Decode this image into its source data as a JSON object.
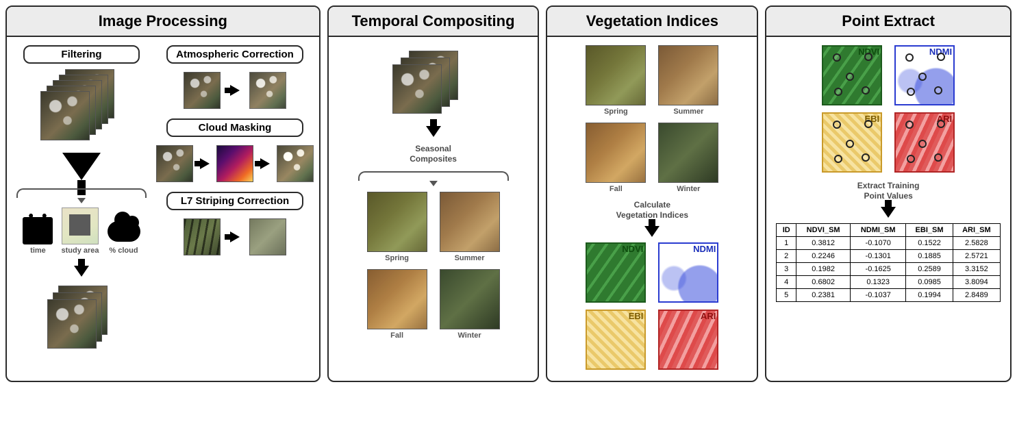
{
  "panels": {
    "image_processing": {
      "title": "Image Processing",
      "filtering_label": "Filtering",
      "atmos_label": "Atmospheric Correction",
      "cloud_label": "Cloud Masking",
      "striping_label": "L7 Striping Correction",
      "time_caption": "time",
      "area_caption": "study area",
      "cloud_caption": "% cloud"
    },
    "temporal": {
      "title": "Temporal Compositing",
      "subtitle": "Seasonal\nComposites",
      "seasons": [
        "Spring",
        "Summer",
        "Fall",
        "Winter"
      ]
    },
    "veg": {
      "title": "Vegetation Indices",
      "calc_label": "Calculate\nVegetation Indices",
      "seasons": [
        "Spring",
        "Summer",
        "Fall",
        "Winter"
      ],
      "indices": {
        "ndvi": "NDVI",
        "ndmi": "NDMI",
        "ebi": "EBI",
        "ari": "ARI"
      }
    },
    "point": {
      "title": "Point Extract",
      "extract_label": "Extract Training\nPoint Values",
      "indices": {
        "ndvi": "NDVI",
        "ndmi": "NDMI",
        "ebi": "EBI",
        "ari": "ARI"
      },
      "table": {
        "headers": [
          "ID",
          "NDVI_SM",
          "NDMI_SM",
          "EBI_SM",
          "ARI_SM"
        ],
        "rows": [
          [
            "1",
            "0.3812",
            "-0.1070",
            "0.1522",
            "2.5828"
          ],
          [
            "2",
            "0.2246",
            "-0.1301",
            "0.1885",
            "2.5721"
          ],
          [
            "3",
            "0.1982",
            "-0.1625",
            "0.2589",
            "3.3152"
          ],
          [
            "4",
            "0.6802",
            "0.1323",
            "0.0985",
            "3.8094"
          ],
          [
            "5",
            "0.2381",
            "-0.1037",
            "0.1994",
            "2.8489"
          ]
        ]
      }
    }
  }
}
